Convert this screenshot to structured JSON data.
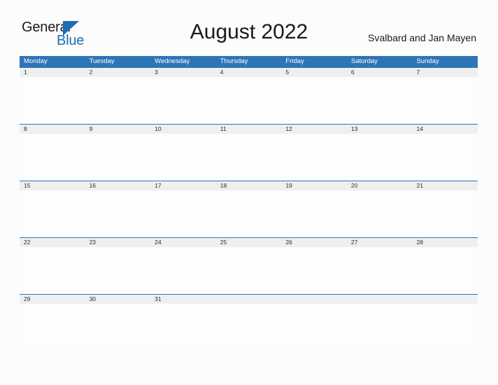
{
  "logo": {
    "word_top": "General",
    "word_bottom": "Blue",
    "accent_color": "#1f6cb5",
    "triangle_icon": "triangle-right-icon"
  },
  "header": {
    "title": "August 2022",
    "region": "Svalbard and Jan Mayen"
  },
  "colors": {
    "header_blue": "#2e75b6",
    "date_band_gray": "#efefef",
    "page_background": "#fcfcfc",
    "text_dark": "#1a1a1a"
  },
  "calendar": {
    "month": "August",
    "year": "2022",
    "weekday_headers": [
      "Monday",
      "Tuesday",
      "Wednesday",
      "Thursday",
      "Friday",
      "Saturday",
      "Sunday"
    ],
    "weeks": [
      {
        "days": [
          "1",
          "2",
          "3",
          "4",
          "5",
          "6",
          "7"
        ]
      },
      {
        "days": [
          "8",
          "9",
          "10",
          "11",
          "12",
          "13",
          "14"
        ]
      },
      {
        "days": [
          "15",
          "16",
          "17",
          "18",
          "19",
          "20",
          "21"
        ]
      },
      {
        "days": [
          "22",
          "23",
          "24",
          "25",
          "26",
          "27",
          "28"
        ]
      },
      {
        "days": [
          "29",
          "30",
          "31",
          "",
          "",
          "",
          ""
        ]
      }
    ]
  }
}
